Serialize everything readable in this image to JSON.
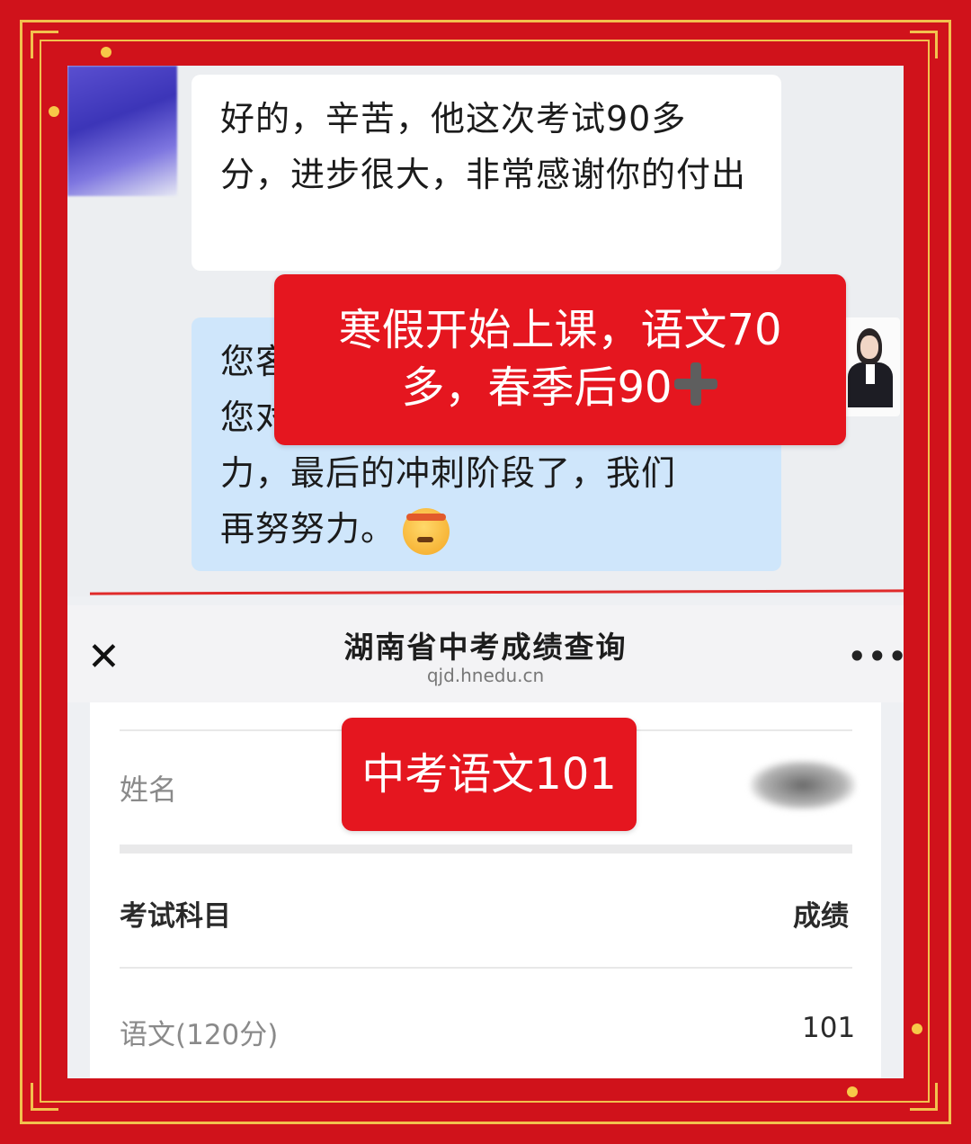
{
  "chat": {
    "incoming_message": "好的，辛苦，他这次考试90多分，进步很大，非常感谢你的付出",
    "outgoing_line_1": "您客",
    "outgoing_line_2": "您对",
    "outgoing_line_3": "力，最后的冲刺阶段了，我们",
    "outgoing_line_4": "再努努力。",
    "emoji_name": "determined-face-emoji"
  },
  "overlays": {
    "label_1_line_1": "寒假开始上课，语文70",
    "label_1_line_2": "多，春季后90",
    "label_2": "中考语文101"
  },
  "page": {
    "title": "湖南省中考成绩查询",
    "url": "qjd.hnedu.cn"
  },
  "result": {
    "name_label": "姓名",
    "table_headers": [
      "考试科目",
      "成绩"
    ],
    "rows": [
      {
        "subject": "语文(120分)",
        "score": "101"
      }
    ]
  },
  "colors": {
    "frame_red": "#d0121b",
    "frame_gold": "#f2c14e",
    "overlay_red": "#e5161f",
    "outgoing_bubble": "#cfe6fb"
  }
}
